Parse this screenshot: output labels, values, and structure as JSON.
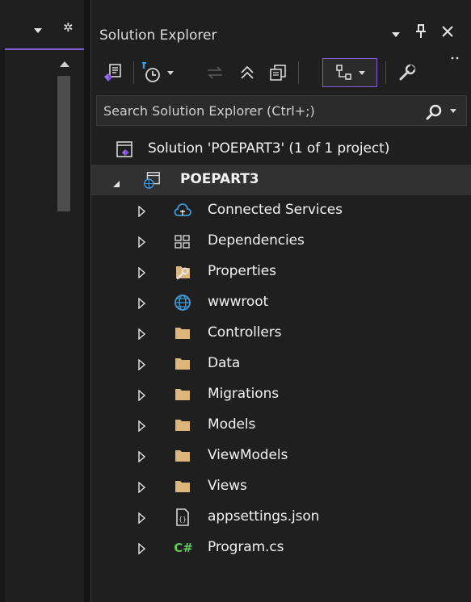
{
  "panel": {
    "title": "Solution Explorer",
    "title_buttons": [
      "window-position-dropdown",
      "pin",
      "close"
    ]
  },
  "search": {
    "placeholder": "Search Solution Explorer (Ctrl+;)"
  },
  "tree": {
    "solution_label": "Solution 'POEPART3' (1 of 1 project)",
    "project_label": "POEPART3",
    "items": [
      {
        "label": "Connected Services",
        "icon": "connected-services-icon"
      },
      {
        "label": "Dependencies",
        "icon": "dependencies-icon"
      },
      {
        "label": "Properties",
        "icon": "properties-icon"
      },
      {
        "label": "wwwroot",
        "icon": "globe-icon"
      },
      {
        "label": "Controllers",
        "icon": "folder-icon"
      },
      {
        "label": "Data",
        "icon": "folder-icon"
      },
      {
        "label": "Migrations",
        "icon": "folder-icon"
      },
      {
        "label": "Models",
        "icon": "folder-icon"
      },
      {
        "label": "ViewModels",
        "icon": "folder-icon"
      },
      {
        "label": "Views",
        "icon": "folder-icon"
      },
      {
        "label": "appsettings.json",
        "icon": "json-file-icon"
      },
      {
        "label": "Program.cs",
        "icon": "csharp-file-icon"
      }
    ]
  },
  "csharp_badge": "C#",
  "json_badge": "{}",
  "colors": {
    "background": "#1f1f1f",
    "accent": "#7e5fd6",
    "folder": "#dcb67a",
    "globe": "#3f9bd8",
    "csharp": "#61c75f",
    "selected_row": "#313131"
  }
}
